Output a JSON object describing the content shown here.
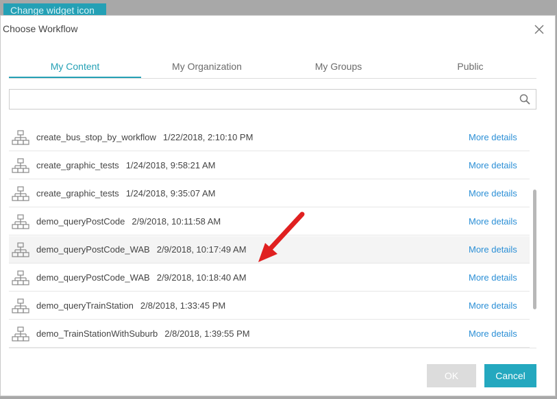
{
  "background": {
    "button_label": "Change widget icon"
  },
  "dialog": {
    "title": "Choose Workflow",
    "tabs": [
      {
        "label": "My Content",
        "active": true
      },
      {
        "label": "My Organization",
        "active": false
      },
      {
        "label": "My Groups",
        "active": false
      },
      {
        "label": "Public",
        "active": false
      }
    ],
    "search": {
      "value": "",
      "placeholder": ""
    },
    "items": [
      {
        "name": "create_bus_stop_by_workflow",
        "date": "1/22/2018, 2:10:10 PM",
        "more": "More details",
        "icon": "workflow-icon"
      },
      {
        "name": "create_graphic_tests",
        "date": "1/24/2018, 9:58:21 AM",
        "more": "More details",
        "icon": "workflow-icon"
      },
      {
        "name": "create_graphic_tests",
        "date": "1/24/2018, 9:35:07 AM",
        "more": "More details",
        "icon": "workflow-icon"
      },
      {
        "name": "demo_queryPostCode",
        "date": "2/9/2018, 10:11:58 AM",
        "more": "More details",
        "icon": "workflow-icon"
      },
      {
        "name": "demo_queryPostCode_WAB",
        "date": "2/9/2018, 10:17:49 AM",
        "more": "More details",
        "icon": "workflow-icon",
        "highlighted": true
      },
      {
        "name": "demo_queryPostCode_WAB",
        "date": "2/9/2018, 10:18:40 AM",
        "more": "More details",
        "icon": "workflow-icon"
      },
      {
        "name": "demo_queryTrainStation",
        "date": "2/8/2018, 1:33:45 PM",
        "more": "More details",
        "icon": "workflow-icon"
      },
      {
        "name": "demo_TrainStationWithSuburb",
        "date": "2/8/2018, 1:39:55 PM",
        "more": "More details",
        "icon": "workflow-icon"
      }
    ],
    "buttons": {
      "ok": "OK",
      "cancel": "Cancel"
    }
  },
  "colors": {
    "accent": "#24a0b5",
    "link": "#2b8fd6",
    "annotation_arrow": "#e02020"
  }
}
